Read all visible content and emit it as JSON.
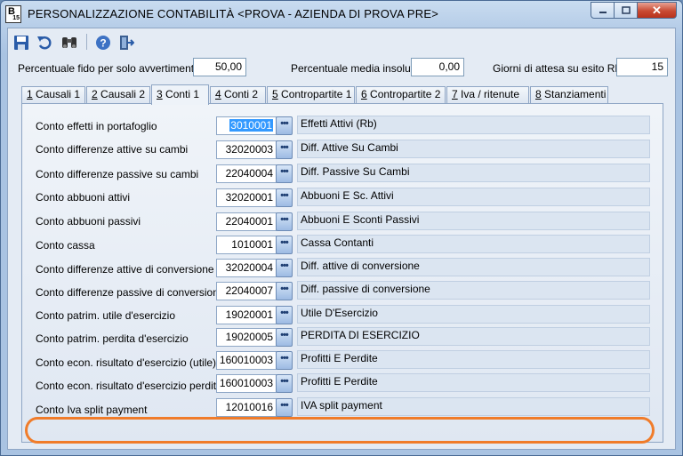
{
  "window": {
    "app_icon_letter": "B",
    "app_icon_sub": "15",
    "title": "PERSONALIZZAZIONE CONTABILITÀ <PROVA - AZIENDA DI PROVA PRE>",
    "close_glyph": "✕"
  },
  "toolbar": {
    "icons": [
      "save-icon",
      "undo-icon",
      "binoculars-icon",
      "help-icon",
      "exit-icon"
    ]
  },
  "header_fields": {
    "fido_label": "Percentuale fido per solo avvertimento",
    "fido_value": "50,00",
    "insoluti_label": "Percentuale media insoluti",
    "insoluti_value": "0,00",
    "giorni_label": "Giorni di attesa su esito RB",
    "giorni_value": "15"
  },
  "tabs": [
    {
      "num": "1",
      "label": " Causali 1"
    },
    {
      "num": "2",
      "label": " Causali 2"
    },
    {
      "num": "3",
      "label": " Conti 1"
    },
    {
      "num": "4",
      "label": " Conti 2"
    },
    {
      "num": "5",
      "label": " Contropartite 1"
    },
    {
      "num": "6",
      "label": " Contropartite 2"
    },
    {
      "num": "7",
      "label": " Iva / ritenute"
    },
    {
      "num": "8",
      "label": " Stanziamenti"
    }
  ],
  "active_tab": "3 Conti 1",
  "lookup_glyph": "•••",
  "rows": [
    {
      "label": "Conto effetti in portafoglio",
      "code": "3010001",
      "desc": "Effetti Attivi (Rb)"
    },
    {
      "label": "Conto differenze attive su cambi",
      "code": "32020003",
      "desc": "Diff. Attive Su Cambi"
    },
    {
      "label": "Conto differenze passive su cambi",
      "code": "22040004",
      "desc": "Diff. Passive Su Cambi"
    },
    {
      "label": "Conto abbuoni attivi",
      "code": "32020001",
      "desc": "Abbuoni E Sc. Attivi"
    },
    {
      "label": "Conto abbuoni passivi",
      "code": "22040001",
      "desc": "Abbuoni E Sconti  Passivi"
    },
    {
      "label": "Conto cassa",
      "code": "1010001",
      "desc": "Cassa Contanti"
    },
    {
      "label": "Conto differenze attive di conversione",
      "code": "32020004",
      "desc": "Diff. attive di conversione"
    },
    {
      "label": "Conto differenze passive di conversione",
      "code": "22040007",
      "desc": "Diff. passive di conversione"
    },
    {
      "label": "Conto patrim. utile d'esercizio",
      "code": "19020001",
      "desc": "Utile D'Esercizio"
    },
    {
      "label": "Conto patrim. perdita d'esercizio",
      "code": "19020005",
      "desc": "PERDITA DI ESERCIZIO"
    },
    {
      "label": "Conto econ. risultato d'esercizio (utile)",
      "code": "160010003",
      "desc": "Profitti E Perdite"
    },
    {
      "label": "Conto econ. risultato d'esercizio perdita)",
      "code": "160010003",
      "desc": "Profitti E Perdite"
    },
    {
      "label": "Conto Iva split payment",
      "code": "12010016",
      "desc": "IVA split payment"
    }
  ],
  "colors": {
    "highlight": "#f07c2a",
    "selection": "#3399ff"
  }
}
